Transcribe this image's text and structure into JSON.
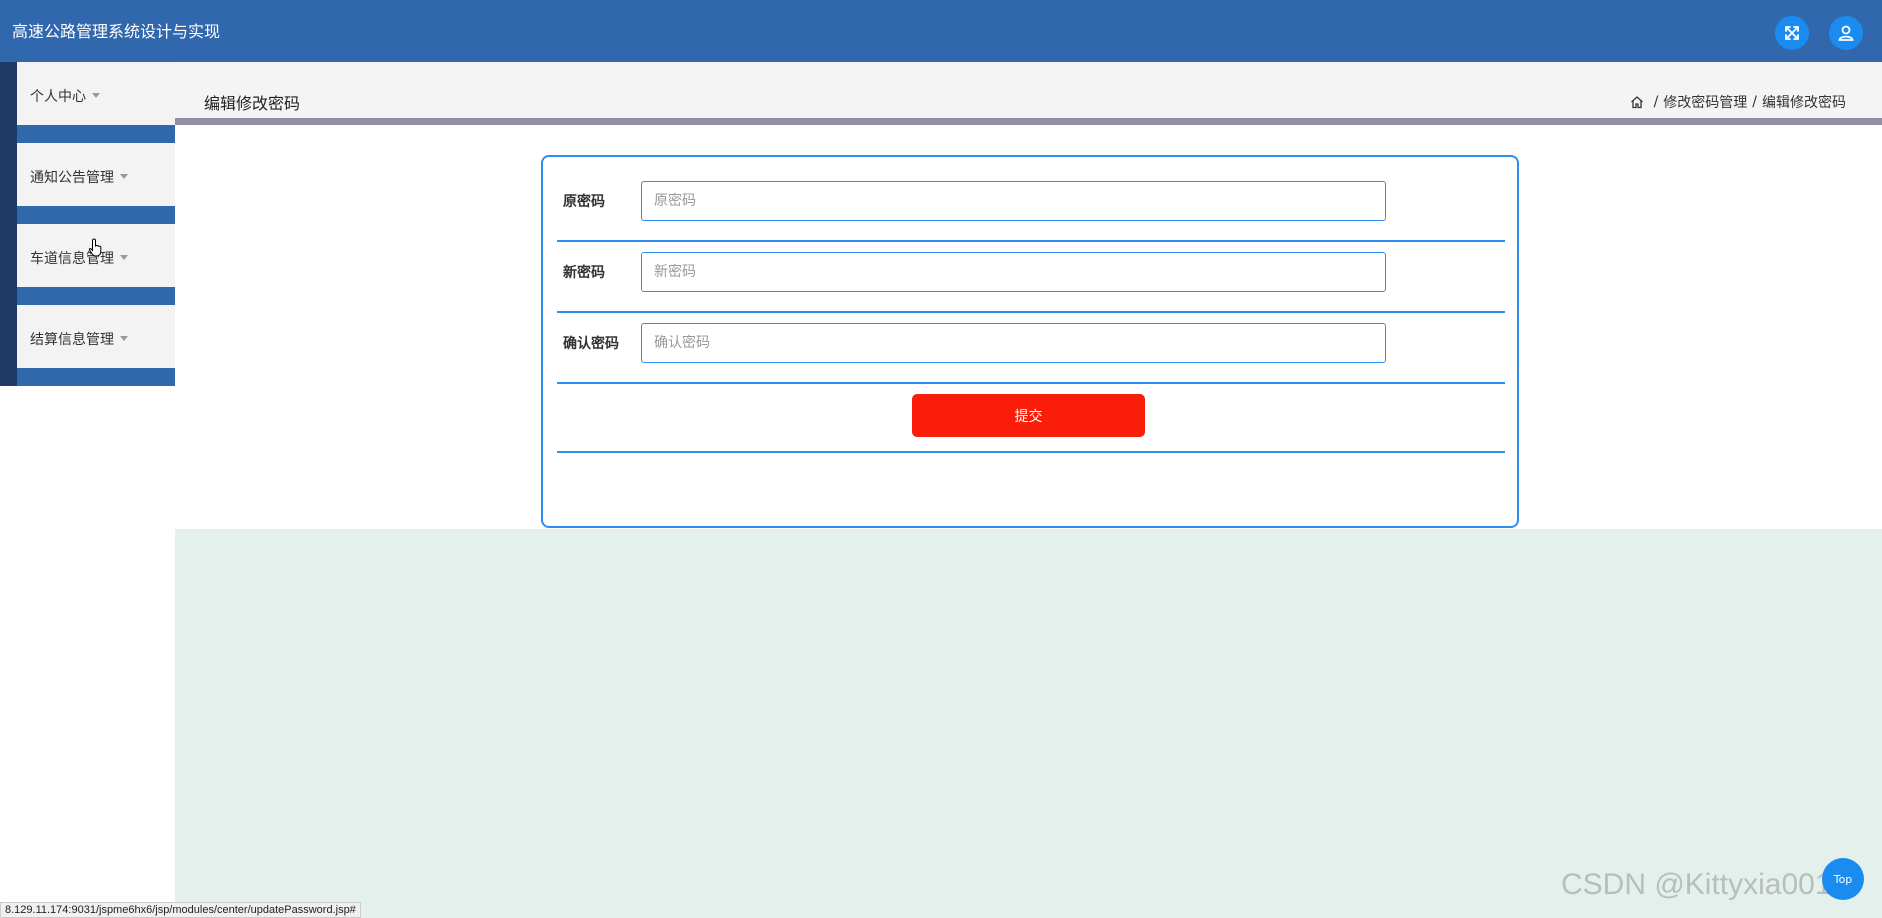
{
  "app": {
    "title": "高速公路管理系统设计与实现"
  },
  "icons": {
    "fullscreen": "expand-arrows-icon",
    "user": "user-icon",
    "home": "home-icon",
    "caret": "caret-down-icon",
    "cursor": "hand-pointer-icon"
  },
  "colors": {
    "topbar": "#3167ad",
    "accent": "#2d8ef0",
    "submit": "#fa1d0a",
    "content_bg": "#e3f0ec"
  },
  "sidebar": {
    "items": [
      {
        "label": "个人中心"
      },
      {
        "label": "通知公告管理"
      },
      {
        "label": "车道信息管理"
      },
      {
        "label": "结算信息管理"
      }
    ]
  },
  "header": {
    "page_title": "编辑修改密码",
    "breadcrumb": [
      "修改密码管理",
      "编辑修改密码"
    ]
  },
  "form": {
    "fields": [
      {
        "label": "原密码",
        "placeholder": "原密码",
        "value": ""
      },
      {
        "label": "新密码",
        "placeholder": "新密码",
        "value": ""
      },
      {
        "label": "确认密码",
        "placeholder": "确认密码",
        "value": ""
      }
    ],
    "submit_label": "提交"
  },
  "status_bar": {
    "url": "8.129.11.174:9031/jspme6hx6/jsp/modules/center/updatePassword.jsp#"
  },
  "back_to_top": {
    "label": "Top"
  },
  "watermark": "CSDN @Kittyxia001"
}
